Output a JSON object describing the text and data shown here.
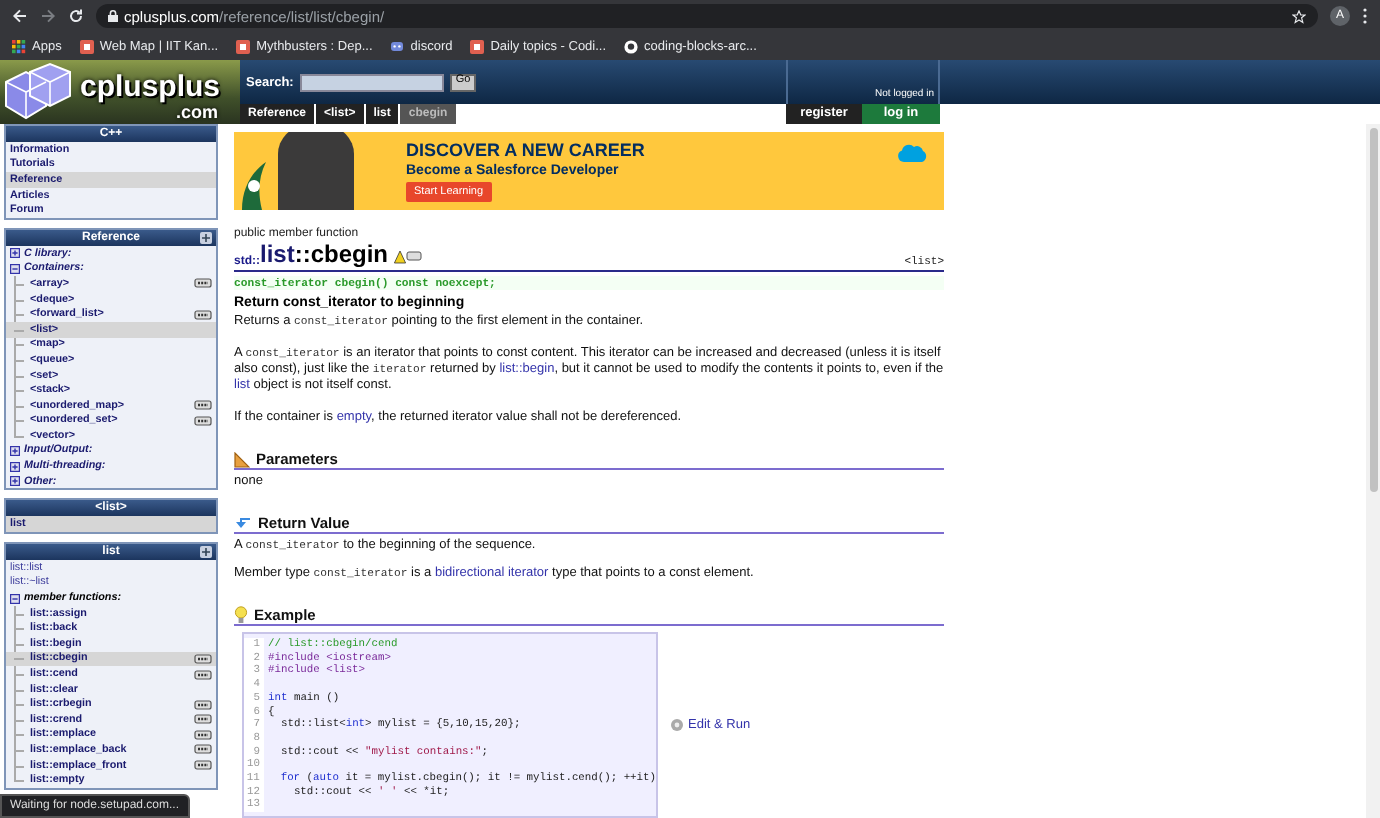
{
  "browser": {
    "url_host": "cplusplus.com",
    "url_path": "/reference/list/list/cbegin/",
    "profile_initial": "A",
    "bookmarks": [
      {
        "label": "Apps",
        "kind": "apps"
      },
      {
        "label": "Web Map | IIT Kan...",
        "kind": "site"
      },
      {
        "label": "Mythbusters : Dep...",
        "kind": "site"
      },
      {
        "label": "discord",
        "kind": "chat"
      },
      {
        "label": "Daily topics - Codi...",
        "kind": "site"
      },
      {
        "label": "coding-blocks-arc...",
        "kind": "repo"
      }
    ]
  },
  "site_header": {
    "logo_text": "cplusplus",
    "logo_domain": ".com",
    "search_label": "Search:",
    "search_button": "Go",
    "login_status": "Not logged in",
    "breadcrumbs": [
      {
        "label": "Reference",
        "selected": false
      },
      {
        "label": "<list>",
        "selected": false
      },
      {
        "label": "list",
        "selected": false
      },
      {
        "label": "cbegin",
        "selected": true
      }
    ],
    "register": "register",
    "login": "log in"
  },
  "sidebar": [
    {
      "title": "C++",
      "collapse_button": false,
      "items": [
        {
          "label": "Information",
          "kind": "link",
          "selected": false
        },
        {
          "label": "Tutorials",
          "kind": "link",
          "selected": false
        },
        {
          "label": "Reference",
          "kind": "link",
          "selected": true
        },
        {
          "label": "Articles",
          "kind": "link",
          "selected": false
        },
        {
          "label": "Forum",
          "kind": "link",
          "selected": false
        }
      ]
    },
    {
      "title": "Reference",
      "collapse_button": true,
      "items": [
        {
          "label": "C library:",
          "kind": "category",
          "expanded": false,
          "selected": false
        },
        {
          "label": "Containers:",
          "kind": "category",
          "expanded": true,
          "selected": false,
          "children": [
            {
              "label": "<array>",
              "selected": false,
              "cpp11": true
            },
            {
              "label": "<deque>",
              "selected": false,
              "cpp11": false
            },
            {
              "label": "<forward_list>",
              "selected": false,
              "cpp11": true
            },
            {
              "label": "<list>",
              "selected": true,
              "cpp11": false
            },
            {
              "label": "<map>",
              "selected": false,
              "cpp11": false
            },
            {
              "label": "<queue>",
              "selected": false,
              "cpp11": false
            },
            {
              "label": "<set>",
              "selected": false,
              "cpp11": false
            },
            {
              "label": "<stack>",
              "selected": false,
              "cpp11": false
            },
            {
              "label": "<unordered_map>",
              "selected": false,
              "cpp11": true
            },
            {
              "label": "<unordered_set>",
              "selected": false,
              "cpp11": true
            },
            {
              "label": "<vector>",
              "selected": false,
              "cpp11": false
            }
          ]
        },
        {
          "label": "Input/Output:",
          "kind": "category",
          "expanded": false,
          "selected": false
        },
        {
          "label": "Multi-threading:",
          "kind": "category",
          "expanded": false,
          "selected": false
        },
        {
          "label": "Other:",
          "kind": "category",
          "expanded": false,
          "selected": false
        }
      ]
    },
    {
      "title": "<list>",
      "collapse_button": false,
      "items": [
        {
          "label": "list",
          "kind": "link",
          "selected": true
        }
      ]
    },
    {
      "title": "list",
      "collapse_button": true,
      "items": [
        {
          "label": "list::list",
          "kind": "plain",
          "selected": false
        },
        {
          "label": "list::~list",
          "kind": "plain",
          "selected": false
        },
        {
          "label": "member functions:",
          "kind": "category",
          "expanded": true,
          "selected": false,
          "children": [
            {
              "label": "list::assign",
              "selected": false,
              "cpp11": false
            },
            {
              "label": "list::back",
              "selected": false,
              "cpp11": false
            },
            {
              "label": "list::begin",
              "selected": false,
              "cpp11": false
            },
            {
              "label": "list::cbegin",
              "selected": true,
              "cpp11": true
            },
            {
              "label": "list::cend",
              "selected": false,
              "cpp11": true
            },
            {
              "label": "list::clear",
              "selected": false,
              "cpp11": false
            },
            {
              "label": "list::crbegin",
              "selected": false,
              "cpp11": true
            },
            {
              "label": "list::crend",
              "selected": false,
              "cpp11": true
            },
            {
              "label": "list::emplace",
              "selected": false,
              "cpp11": true
            },
            {
              "label": "list::emplace_back",
              "selected": false,
              "cpp11": true
            },
            {
              "label": "list::emplace_front",
              "selected": false,
              "cpp11": true
            },
            {
              "label": "list::empty",
              "selected": false,
              "cpp11": false
            }
          ]
        }
      ]
    }
  ],
  "ad": {
    "headline": "DISCOVER A NEW CAREER",
    "subline": "Become a Salesforce Developer",
    "button": "Start Learning"
  },
  "article": {
    "kind_label": "public member function",
    "namespace": "std::",
    "container": "list",
    "member": "::cbegin",
    "cpp11": true,
    "header_link": "<list>",
    "signature": "const_iterator cbegin() const noexcept;",
    "summary": "Return const_iterator to beginning",
    "paragraphs": [
      [
        {
          "kind": "text",
          "text": "Returns a "
        },
        {
          "kind": "code",
          "text": "const_iterator"
        },
        {
          "kind": "text",
          "text": " pointing to the first element in the container."
        }
      ],
      [
        {
          "kind": "text",
          "text": "A "
        },
        {
          "kind": "code",
          "text": "const_iterator"
        },
        {
          "kind": "text",
          "text": " is an iterator that points to const content. This iterator can be increased and decreased (unless it is itself also const), just like the "
        },
        {
          "kind": "code",
          "text": "iterator"
        },
        {
          "kind": "text",
          "text": " returned by "
        },
        {
          "kind": "link",
          "text": "list::begin"
        },
        {
          "kind": "text",
          "text": ", but it cannot be used to modify the contents it points to, even if the "
        },
        {
          "kind": "link",
          "text": "list"
        },
        {
          "kind": "text",
          "text": " object is not itself const."
        }
      ],
      [
        {
          "kind": "text",
          "text": "If the container is "
        },
        {
          "kind": "link",
          "text": "empty"
        },
        {
          "kind": "text",
          "text": ", the returned iterator value shall not be dereferenced."
        }
      ]
    ],
    "sections": [
      {
        "kind": "parameters",
        "title": "Parameters",
        "paragraphs": [
          [
            {
              "kind": "text",
              "text": "none"
            }
          ]
        ]
      },
      {
        "kind": "return",
        "title": "Return Value",
        "paragraphs": [
          [
            {
              "kind": "text",
              "text": "A "
            },
            {
              "kind": "code",
              "text": "const_iterator"
            },
            {
              "kind": "text",
              "text": " to the beginning of the sequence."
            }
          ],
          [
            {
              "kind": "text",
              "text": "Member type "
            },
            {
              "kind": "code",
              "text": "const_iterator"
            },
            {
              "kind": "text",
              "text": " is a "
            },
            {
              "kind": "link",
              "text": "bidirectional iterator"
            },
            {
              "kind": "text",
              "text": " type that points to a const element."
            }
          ]
        ]
      },
      {
        "kind": "example",
        "title": "Example",
        "action": "Edit & Run",
        "code": [
          {
            "number": "1",
            "segments": [
              {
                "kind": "comment",
                "text": "// list::cbegin/cend"
              }
            ]
          },
          {
            "number": "2",
            "segments": [
              {
                "kind": "preproc",
                "text": "#include <iostream>"
              }
            ]
          },
          {
            "number": "3",
            "segments": [
              {
                "kind": "preproc",
                "text": "#include <list>"
              }
            ]
          },
          {
            "number": "4"
          },
          {
            "number": "5",
            "segments": [
              {
                "kind": "keyword",
                "text": "int"
              },
              {
                "kind": "plain",
                "text": " main ()"
              }
            ]
          },
          {
            "number": "6",
            "segments": [
              {
                "kind": "plain",
                "text": "{"
              }
            ]
          },
          {
            "number": "7",
            "segments": [
              {
                "kind": "plain",
                "text": "  std::list<"
              },
              {
                "kind": "keyword",
                "text": "int"
              },
              {
                "kind": "plain",
                "text": "> mylist = {5,10,15,20};"
              }
            ]
          },
          {
            "number": "8"
          },
          {
            "number": "9",
            "segments": [
              {
                "kind": "plain",
                "text": "  std::cout << "
              },
              {
                "kind": "string",
                "text": "\"mylist contains:\""
              },
              {
                "kind": "plain",
                "text": ";"
              }
            ]
          },
          {
            "number": "10"
          },
          {
            "number": "11",
            "segments": [
              {
                "kind": "keyword",
                "text": "  for"
              },
              {
                "kind": "plain",
                "text": " ("
              },
              {
                "kind": "keyword",
                "text": "auto"
              },
              {
                "kind": "plain",
                "text": " it = mylist.cbegin(); it != mylist.cend(); ++it)"
              }
            ]
          },
          {
            "number": "12",
            "segments": [
              {
                "kind": "plain",
                "text": "    std::cout << "
              },
              {
                "kind": "string",
                "text": "' '"
              },
              {
                "kind": "plain",
                "text": " << *it;"
              }
            ]
          },
          {
            "number": "13"
          }
        ]
      }
    ]
  },
  "status_bar": "Waiting for node.setupad.com..."
}
